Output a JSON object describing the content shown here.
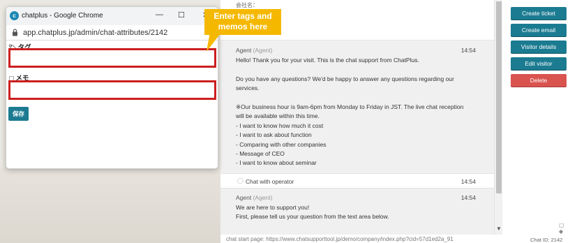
{
  "popup": {
    "window_title": "chatplus - Google Chrome",
    "url": "app.chatplus.jp/admin/chat-attributes/2142",
    "tag_label": "タグ",
    "memo_label": "メモ",
    "save_label": "保存",
    "tag_value": "",
    "memo_value": ""
  },
  "callout": {
    "line1": "Enter tags and",
    "line2": "memos here",
    "color": "#f5b800"
  },
  "chat": {
    "company_label": "会社名：",
    "messages": [
      {
        "sender": "Agent",
        "role": "(Agent)",
        "time": "14:54",
        "lines": [
          "Hello! Thank you for your visit. This is the chat support from ChatPlus.",
          "",
          "Do you have any questions? We'd be happy to answer any questions regarding our",
          "services.",
          "",
          "※Our business hour is 9am-6pm from Monday to Friday in JST. The live chat reception",
          "will be available within this time.",
          "- I want to know how much it cost",
          "- I want to ask about function",
          "- Comparing with other companies",
          "- Message of CEO",
          "- I want to know about seminar"
        ]
      },
      {
        "sender": "Agent",
        "role": "(Agent)",
        "time": "14:54",
        "lines": [
          "We are here to support you!",
          "First, please tell us your question from the text area below."
        ]
      }
    ],
    "operator_label": "Chat with operator",
    "operator_time": "14:54",
    "footer": "chat start page: https://www.chatsupporttool.jp/demo/company/index.php?cid=57d1ed2a_91"
  },
  "actions": {
    "create_ticket": "Create ticket",
    "create_email": "Create email",
    "visitor_details": "Visitor details",
    "edit_visitor": "Edit visitor",
    "delete": "Delete",
    "accent_color": "#1b7b91",
    "delete_color": "#d9534f"
  },
  "chat_id_label": "Chat ID:",
  "chat_id_value": "2142"
}
